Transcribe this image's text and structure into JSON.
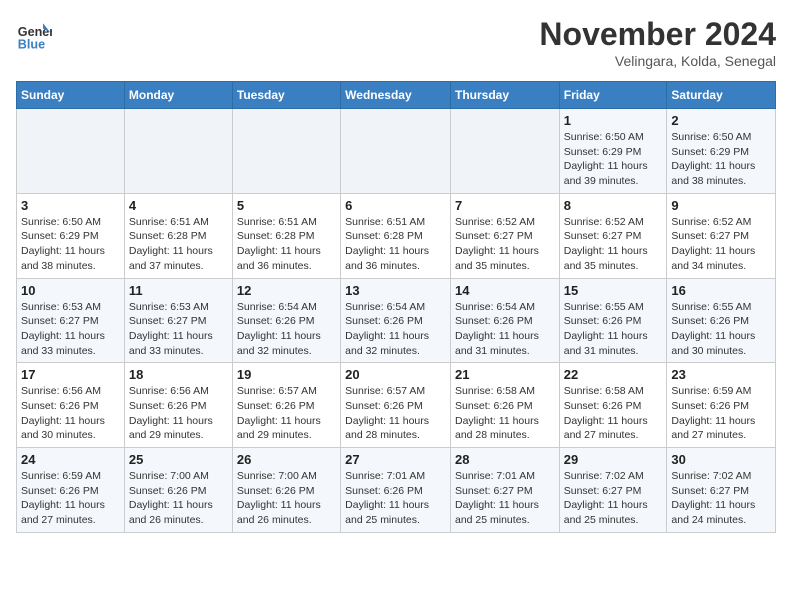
{
  "logo": {
    "text_general": "General",
    "text_blue": "Blue"
  },
  "title": "November 2024",
  "subtitle": "Velingara, Kolda, Senegal",
  "weekdays": [
    "Sunday",
    "Monday",
    "Tuesday",
    "Wednesday",
    "Thursday",
    "Friday",
    "Saturday"
  ],
  "weeks": [
    [
      {
        "day": "",
        "info": ""
      },
      {
        "day": "",
        "info": ""
      },
      {
        "day": "",
        "info": ""
      },
      {
        "day": "",
        "info": ""
      },
      {
        "day": "",
        "info": ""
      },
      {
        "day": "1",
        "info": "Sunrise: 6:50 AM\nSunset: 6:29 PM\nDaylight: 11 hours and 39 minutes."
      },
      {
        "day": "2",
        "info": "Sunrise: 6:50 AM\nSunset: 6:29 PM\nDaylight: 11 hours and 38 minutes."
      }
    ],
    [
      {
        "day": "3",
        "info": "Sunrise: 6:50 AM\nSunset: 6:29 PM\nDaylight: 11 hours and 38 minutes."
      },
      {
        "day": "4",
        "info": "Sunrise: 6:51 AM\nSunset: 6:28 PM\nDaylight: 11 hours and 37 minutes."
      },
      {
        "day": "5",
        "info": "Sunrise: 6:51 AM\nSunset: 6:28 PM\nDaylight: 11 hours and 36 minutes."
      },
      {
        "day": "6",
        "info": "Sunrise: 6:51 AM\nSunset: 6:28 PM\nDaylight: 11 hours and 36 minutes."
      },
      {
        "day": "7",
        "info": "Sunrise: 6:52 AM\nSunset: 6:27 PM\nDaylight: 11 hours and 35 minutes."
      },
      {
        "day": "8",
        "info": "Sunrise: 6:52 AM\nSunset: 6:27 PM\nDaylight: 11 hours and 35 minutes."
      },
      {
        "day": "9",
        "info": "Sunrise: 6:52 AM\nSunset: 6:27 PM\nDaylight: 11 hours and 34 minutes."
      }
    ],
    [
      {
        "day": "10",
        "info": "Sunrise: 6:53 AM\nSunset: 6:27 PM\nDaylight: 11 hours and 33 minutes."
      },
      {
        "day": "11",
        "info": "Sunrise: 6:53 AM\nSunset: 6:27 PM\nDaylight: 11 hours and 33 minutes."
      },
      {
        "day": "12",
        "info": "Sunrise: 6:54 AM\nSunset: 6:26 PM\nDaylight: 11 hours and 32 minutes."
      },
      {
        "day": "13",
        "info": "Sunrise: 6:54 AM\nSunset: 6:26 PM\nDaylight: 11 hours and 32 minutes."
      },
      {
        "day": "14",
        "info": "Sunrise: 6:54 AM\nSunset: 6:26 PM\nDaylight: 11 hours and 31 minutes."
      },
      {
        "day": "15",
        "info": "Sunrise: 6:55 AM\nSunset: 6:26 PM\nDaylight: 11 hours and 31 minutes."
      },
      {
        "day": "16",
        "info": "Sunrise: 6:55 AM\nSunset: 6:26 PM\nDaylight: 11 hours and 30 minutes."
      }
    ],
    [
      {
        "day": "17",
        "info": "Sunrise: 6:56 AM\nSunset: 6:26 PM\nDaylight: 11 hours and 30 minutes."
      },
      {
        "day": "18",
        "info": "Sunrise: 6:56 AM\nSunset: 6:26 PM\nDaylight: 11 hours and 29 minutes."
      },
      {
        "day": "19",
        "info": "Sunrise: 6:57 AM\nSunset: 6:26 PM\nDaylight: 11 hours and 29 minutes."
      },
      {
        "day": "20",
        "info": "Sunrise: 6:57 AM\nSunset: 6:26 PM\nDaylight: 11 hours and 28 minutes."
      },
      {
        "day": "21",
        "info": "Sunrise: 6:58 AM\nSunset: 6:26 PM\nDaylight: 11 hours and 28 minutes."
      },
      {
        "day": "22",
        "info": "Sunrise: 6:58 AM\nSunset: 6:26 PM\nDaylight: 11 hours and 27 minutes."
      },
      {
        "day": "23",
        "info": "Sunrise: 6:59 AM\nSunset: 6:26 PM\nDaylight: 11 hours and 27 minutes."
      }
    ],
    [
      {
        "day": "24",
        "info": "Sunrise: 6:59 AM\nSunset: 6:26 PM\nDaylight: 11 hours and 27 minutes."
      },
      {
        "day": "25",
        "info": "Sunrise: 7:00 AM\nSunset: 6:26 PM\nDaylight: 11 hours and 26 minutes."
      },
      {
        "day": "26",
        "info": "Sunrise: 7:00 AM\nSunset: 6:26 PM\nDaylight: 11 hours and 26 minutes."
      },
      {
        "day": "27",
        "info": "Sunrise: 7:01 AM\nSunset: 6:26 PM\nDaylight: 11 hours and 25 minutes."
      },
      {
        "day": "28",
        "info": "Sunrise: 7:01 AM\nSunset: 6:27 PM\nDaylight: 11 hours and 25 minutes."
      },
      {
        "day": "29",
        "info": "Sunrise: 7:02 AM\nSunset: 6:27 PM\nDaylight: 11 hours and 25 minutes."
      },
      {
        "day": "30",
        "info": "Sunrise: 7:02 AM\nSunset: 6:27 PM\nDaylight: 11 hours and 24 minutes."
      }
    ]
  ]
}
